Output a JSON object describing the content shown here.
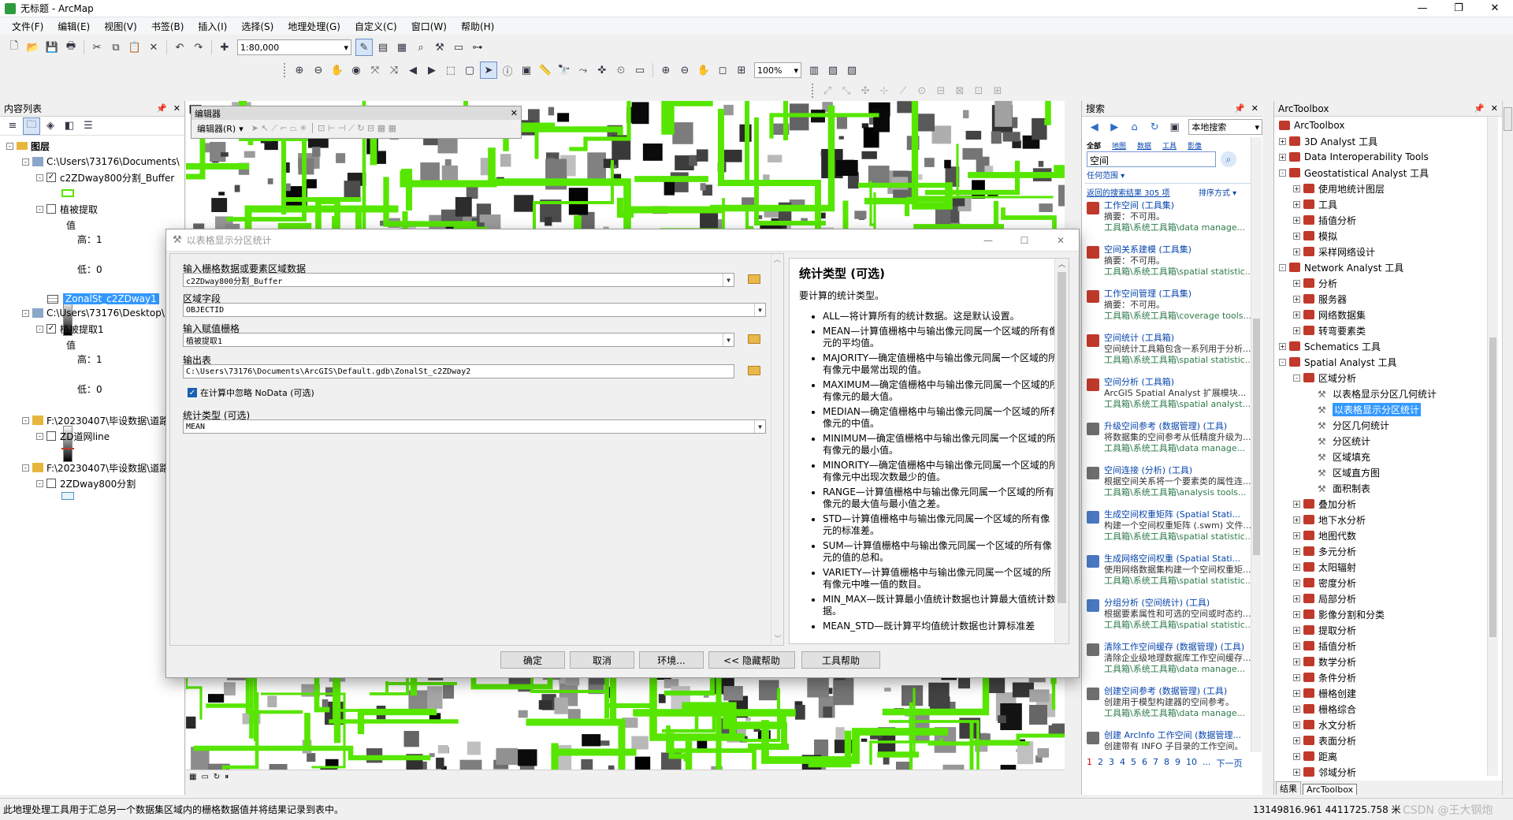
{
  "window": {
    "title": "无标题 - ArcMap",
    "buttons": [
      "—",
      "❐",
      "✕"
    ]
  },
  "menu": [
    "文件(F)",
    "编辑(E)",
    "视图(V)",
    "书签(B)",
    "插入(I)",
    "选择(S)",
    "地理处理(G)",
    "自定义(C)",
    "窗口(W)",
    "帮助(H)"
  ],
  "toolbar": {
    "scale": "1:80,000",
    "zoom": "100%"
  },
  "toc": {
    "title": "内容列表",
    "layers_root": "图层",
    "items": [
      {
        "label": "C:\\Users\\73176\\Documents\\",
        "type": "folder"
      },
      {
        "label": "c2ZDway800分割_Buffer",
        "type": "layer",
        "checked": true
      },
      {
        "label": "植被提取",
        "type": "layer",
        "checked": false
      },
      {
        "label": "值",
        "type": "legend"
      },
      {
        "label": "高：1",
        "type": "legend"
      },
      {
        "label": "低：0",
        "type": "legend"
      },
      {
        "label": "ZonalSt_c2ZDway1",
        "type": "table",
        "selected": true
      },
      {
        "label": "C:\\Users\\73176\\Desktop\\",
        "type": "folder"
      },
      {
        "label": "植被提取1",
        "type": "layer",
        "checked": true
      },
      {
        "label": "值",
        "type": "legend"
      },
      {
        "label": "高：1",
        "type": "legend"
      },
      {
        "label": "低：0",
        "type": "legend"
      },
      {
        "label": "F:\\20230407\\毕设数据\\道路",
        "type": "folder"
      },
      {
        "label": "ZD道网line",
        "type": "layer",
        "checked": false
      },
      {
        "label": "F:\\20230407\\毕设数据\\道路",
        "type": "folder"
      },
      {
        "label": "2ZDway800分割",
        "type": "layer",
        "checked": false
      }
    ]
  },
  "editor": {
    "title": "编辑器",
    "menu": "编辑器(R)"
  },
  "dialog": {
    "title": "以表格显示分区统计",
    "f1_label": "输入栅格数据或要素区域数据",
    "f1_value": "c2ZDway800分割_Buffer",
    "f2_label": "区域字段",
    "f2_value": "OBJECTID",
    "f3_label": "输入赋值栅格",
    "f3_value": "植被提取1",
    "f4_label": "输出表",
    "f4_value": "C:\\Users\\73176\\Documents\\ArcGIS\\Default.gdb\\ZonalSt_c2ZDway2",
    "nodata_label": "在计算中忽略 NoData (可选)",
    "nodata_checked": true,
    "f5_label": "统计类型 (可选)",
    "f5_value": "MEAN",
    "buttons": {
      "ok": "确定",
      "cancel": "取消",
      "env": "环境...",
      "hide_help": "<< 隐藏帮助",
      "tool_help": "工具帮助"
    },
    "help": {
      "heading": "统计类型 (可选)",
      "intro": "要计算的统计类型。",
      "items": [
        "ALL—将计算所有的统计数据。这是默认设置。",
        "MEAN—计算值栅格中与输出像元同属一个区域的所有像元的平均值。",
        "MAJORITY—确定值栅格中与输出像元同属一个区域的所有像元中最常出现的值。",
        "MAXIMUM—确定值栅格中与输出像元同属一个区域的所有像元的最大值。",
        "MEDIAN—确定值栅格中与输出像元同属一个区域的所有像元的中值。",
        "MINIMUM—确定值栅格中与输出像元同属一个区域的所有像元的最小值。",
        "MINORITY—确定值栅格中与输出像元同属一个区域的所有像元中出现次数最少的值。",
        "RANGE—计算值栅格中与输出像元同属一个区域的所有像元的最大值与最小值之差。",
        "STD—计算值栅格中与输出像元同属一个区域的所有像元的标准差。",
        "SUM—计算值栅格中与输出像元同属一个区域的所有像元的值的总和。",
        "VARIETY—计算值栅格中与输出像元同属一个区域的所有像元中唯一值的数目。",
        "MIN_MAX—既计算最小值统计数据也计算最大值统计数据。",
        "MEAN_STD—既计算平均值统计数据也计算标准差"
      ]
    }
  },
  "search": {
    "title": "搜索",
    "scope": "本地搜索",
    "filters": [
      "全部",
      "地图",
      "数据",
      "工具",
      "影像"
    ],
    "query": "空间",
    "extent_link": "任何范围",
    "result_count": "返回的搜索结果 305 项",
    "sort": "排序方式",
    "results": [
      {
        "title": "工作空间 (工具集)",
        "summary": "摘要：不可用。",
        "path": "工具箱\\系统工具箱\\data manage...",
        "icon": "r"
      },
      {
        "title": "空间关系建模 (工具集)",
        "summary": "摘要：不可用。",
        "path": "工具箱\\系统工具箱\\spatial statistic...",
        "icon": "r"
      },
      {
        "title": "工作空间管理 (工具集)",
        "summary": "摘要：不可用。",
        "path": "工具箱\\系统工具箱\\coverage tools...",
        "icon": "r"
      },
      {
        "title": "空间统计 (工具箱)",
        "summary": "空间统计工具箱包含一系列用于分析...",
        "path": "工具箱\\系统工具箱\\spatial statistic...",
        "icon": "r"
      },
      {
        "title": "空间分析 (工具箱)",
        "summary": "ArcGIS Spatial Analyst 扩展模块...",
        "path": "工具箱\\系统工具箱\\spatial analyst...",
        "icon": "r"
      },
      {
        "title": "升级空间参考 (数据管理) (工具)",
        "summary": "将数据集的空间参考从低精度升级为...",
        "path": "工具箱\\系统工具箱\\data manage...",
        "icon": "h"
      },
      {
        "title": "空间连接 (分析) (工具)",
        "summary": "根据空间关系将一个要素类的属性连...",
        "path": "工具箱\\系统工具箱\\analysis tools...",
        "icon": "h"
      },
      {
        "title": "生成空间权重矩阵 (Spatial Stati...",
        "summary": "构建一个空间权重矩阵 (.swm) 文件...",
        "path": "工具箱\\系统工具箱\\spatial statistic...",
        "icon": "b"
      },
      {
        "title": "生成网络空间权重 (Spatial Stati...",
        "summary": "使用网络数据集构建一个空间权重矩...",
        "path": "工具箱\\系统工具箱\\spatial statistic...",
        "icon": "b"
      },
      {
        "title": "分组分析 (空间统计) (工具)",
        "summary": "根据要素属性和可选的空间或时态约...",
        "path": "工具箱\\系统工具箱\\spatial statistic...",
        "icon": "b"
      },
      {
        "title": "清除工作空间缓存 (数据管理) (工具)",
        "summary": "清除企业级地理数据库工作空间缓存...",
        "path": "工具箱\\系统工具箱\\data manage...",
        "icon": "h"
      },
      {
        "title": "创建空间参考 (数据管理) (工具)",
        "summary": "创建用于模型构建器的空间参考。",
        "path": "工具箱\\系统工具箱\\data manage...",
        "icon": "h"
      },
      {
        "title": "创建 ArcInfo 工作空间 (数据管理...",
        "summary": "创建带有 INFO 子目录的工作空间。",
        "path": "工具箱\\系统工具箱\\data manage...",
        "icon": "h"
      }
    ],
    "pages": [
      "1",
      "2",
      "3",
      "4",
      "5",
      "6",
      "7",
      "8",
      "9",
      "10",
      "..."
    ],
    "next": "下一页"
  },
  "arctoolbox": {
    "title": "ArcToolbox",
    "root": "ArcToolbox",
    "items": [
      {
        "label": "3D Analyst 工具",
        "level": 1,
        "exp": "+",
        "kind": "box"
      },
      {
        "label": "Data Interoperability Tools",
        "level": 1,
        "exp": "+",
        "kind": "box"
      },
      {
        "label": "Geostatistical Analyst 工具",
        "level": 1,
        "exp": "-",
        "kind": "box"
      },
      {
        "label": "使用地统计图层",
        "level": 2,
        "exp": "+",
        "kind": "box"
      },
      {
        "label": "工具",
        "level": 2,
        "exp": "+",
        "kind": "box"
      },
      {
        "label": "插值分析",
        "level": 2,
        "exp": "+",
        "kind": "box"
      },
      {
        "label": "模拟",
        "level": 2,
        "exp": "+",
        "kind": "box"
      },
      {
        "label": "采样网络设计",
        "level": 2,
        "exp": "+",
        "kind": "box"
      },
      {
        "label": "Network Analyst 工具",
        "level": 1,
        "exp": "-",
        "kind": "box"
      },
      {
        "label": "分析",
        "level": 2,
        "exp": "+",
        "kind": "box"
      },
      {
        "label": "服务器",
        "level": 2,
        "exp": "+",
        "kind": "box"
      },
      {
        "label": "网络数据集",
        "level": 2,
        "exp": "+",
        "kind": "box"
      },
      {
        "label": "转弯要素类",
        "level": 2,
        "exp": "+",
        "kind": "box"
      },
      {
        "label": "Schematics 工具",
        "level": 1,
        "exp": "+",
        "kind": "box"
      },
      {
        "label": "Spatial Analyst 工具",
        "level": 1,
        "exp": "-",
        "kind": "box"
      },
      {
        "label": "区域分析",
        "level": 2,
        "exp": "-",
        "kind": "box"
      },
      {
        "label": "以表格显示分区几何统计",
        "level": 3,
        "exp": "",
        "kind": "tool"
      },
      {
        "label": "以表格显示分区统计",
        "level": 3,
        "exp": "",
        "kind": "tool",
        "selected": true
      },
      {
        "label": "分区几何统计",
        "level": 3,
        "exp": "",
        "kind": "tool"
      },
      {
        "label": "分区统计",
        "level": 3,
        "exp": "",
        "kind": "tool"
      },
      {
        "label": "区域填充",
        "level": 3,
        "exp": "",
        "kind": "tool"
      },
      {
        "label": "区域直方图",
        "level": 3,
        "exp": "",
        "kind": "tool"
      },
      {
        "label": "面积制表",
        "level": 3,
        "exp": "",
        "kind": "tool"
      },
      {
        "label": "叠加分析",
        "level": 2,
        "exp": "+",
        "kind": "box"
      },
      {
        "label": "地下水分析",
        "level": 2,
        "exp": "+",
        "kind": "box"
      },
      {
        "label": "地图代数",
        "level": 2,
        "exp": "+",
        "kind": "box"
      },
      {
        "label": "多元分析",
        "level": 2,
        "exp": "+",
        "kind": "box"
      },
      {
        "label": "太阳辐射",
        "level": 2,
        "exp": "+",
        "kind": "box"
      },
      {
        "label": "密度分析",
        "level": 2,
        "exp": "+",
        "kind": "box"
      },
      {
        "label": "局部分析",
        "level": 2,
        "exp": "+",
        "kind": "box"
      },
      {
        "label": "影像分割和分类",
        "level": 2,
        "exp": "+",
        "kind": "box"
      },
      {
        "label": "提取分析",
        "level": 2,
        "exp": "+",
        "kind": "box"
      },
      {
        "label": "插值分析",
        "level": 2,
        "exp": "+",
        "kind": "box"
      },
      {
        "label": "数学分析",
        "level": 2,
        "exp": "+",
        "kind": "box"
      },
      {
        "label": "条件分析",
        "level": 2,
        "exp": "+",
        "kind": "box"
      },
      {
        "label": "栅格创建",
        "level": 2,
        "exp": "+",
        "kind": "box"
      },
      {
        "label": "栅格综合",
        "level": 2,
        "exp": "+",
        "kind": "box"
      },
      {
        "label": "水文分析",
        "level": 2,
        "exp": "+",
        "kind": "box"
      },
      {
        "label": "表面分析",
        "level": 2,
        "exp": "+",
        "kind": "box"
      },
      {
        "label": "距离",
        "level": 2,
        "exp": "+",
        "kind": "box"
      },
      {
        "label": "邻域分析",
        "level": 2,
        "exp": "+",
        "kind": "box"
      }
    ],
    "tabs": [
      "结果",
      "ArcToolbox"
    ]
  },
  "status": {
    "message": "此地理处理工具用于汇总另一个数据集区域内的栅格数据值并将结果记录到表中。",
    "coords": "13149816.961  4411725.758 米"
  },
  "watermark": "CSDN @王大钢炮",
  "colors": {
    "road": "#57e600",
    "accent": "#0645ad",
    "selection": "#3399ff"
  }
}
